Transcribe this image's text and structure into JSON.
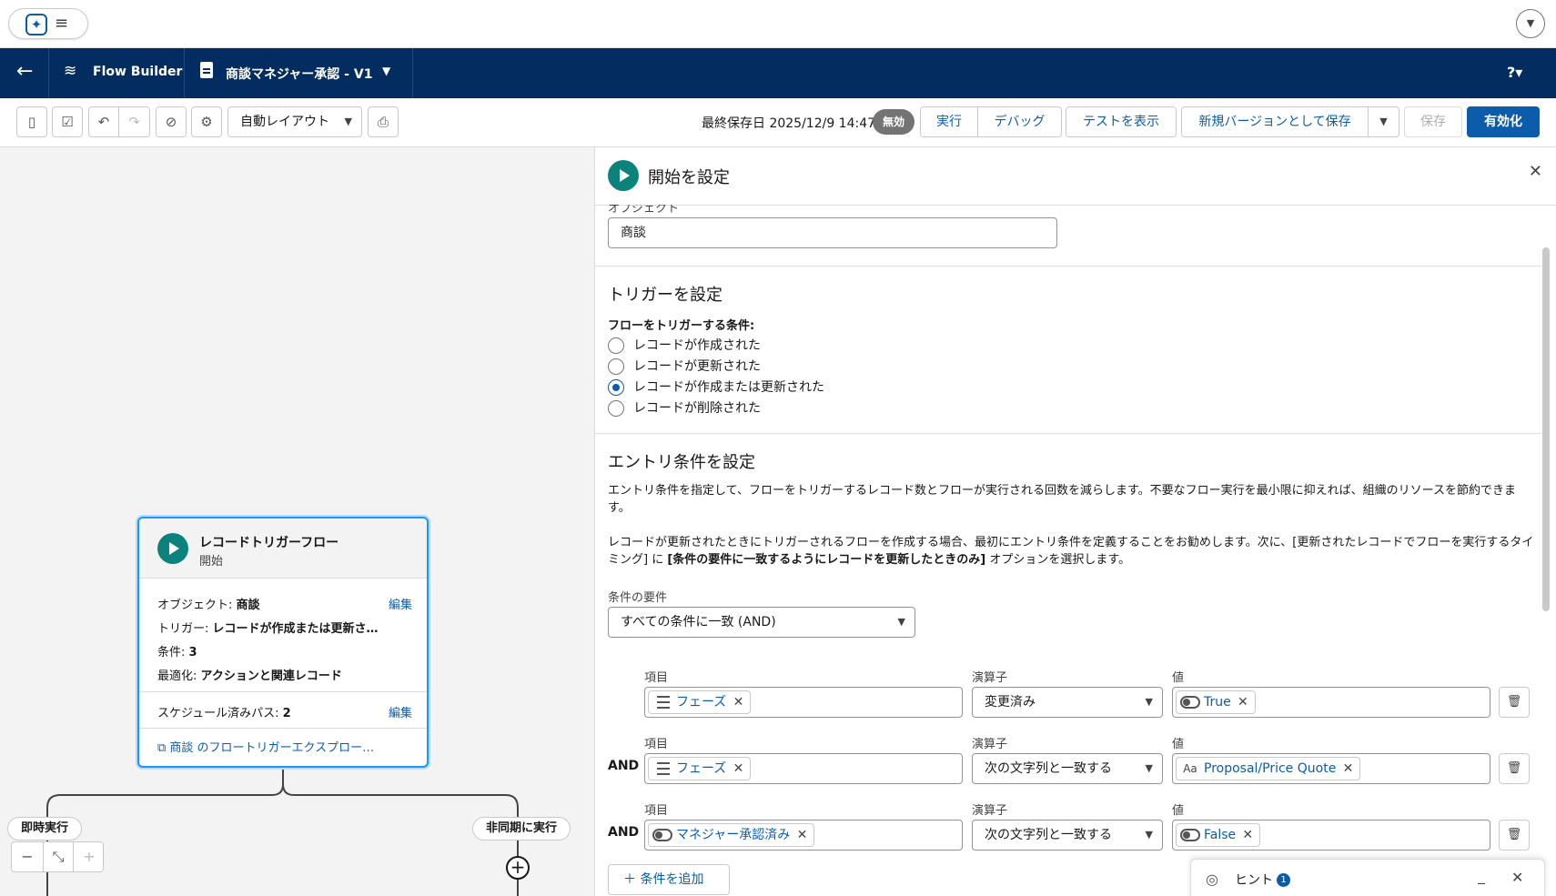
{
  "header": {
    "help_label": "?▾"
  },
  "nav": {
    "brand": "Flow Builder",
    "flow_name": "商談マネジャー承認 - V1"
  },
  "toolbar": {
    "layout_select": "自動レイアウト",
    "last_saved": "最終保存日 2025/12/9 14:47",
    "status_badge": "無効",
    "run": "実行",
    "debug": "デバッグ",
    "show_tests": "テストを表示",
    "save_as_new_version": "新規バージョンとして保存",
    "save": "保存",
    "activate": "有効化"
  },
  "canvas": {
    "node": {
      "title": "レコードトリガーフロー",
      "subtitle": "開始",
      "object_label": "オブジェクト: ",
      "object_value": "商談",
      "trigger_label": "トリガー: ",
      "trigger_value": "レコードが作成または更新さ…",
      "conditions_label": "条件: ",
      "conditions_value": "3",
      "optimize_label": "最適化: ",
      "optimize_value": "アクションと関連レコード",
      "scheduled_label": "スケジュール済みパス: ",
      "scheduled_value": "2",
      "edit": "編集",
      "explorer_link": "商談 のフロートリガーエクスプロー…"
    },
    "path_immediate": "即時実行",
    "path_async": "非同期に実行"
  },
  "panel": {
    "title": "開始を設定",
    "object_label": "オブジェクト",
    "object_value": "商談",
    "trigger_heading": "トリガーを設定",
    "trigger_question": "フローをトリガーする条件:",
    "trigger_options": [
      "レコードが作成された",
      "レコードが更新された",
      "レコードが作成または更新された",
      "レコードが削除された"
    ],
    "trigger_selected": 2,
    "entry_heading": "エントリ条件を設定",
    "entry_desc1": "エントリ条件を指定して、フローをトリガーするレコード数とフローが実行される回数を減らします。不要なフロー実行を最小限に抑えれば、組織のリソースを節約できます。",
    "entry_desc2_a": "レコードが更新されたときにトリガーされるフローを作成する場合、最初にエントリ条件を定義することをお勧めします。次に、[更新されたレコードでフローを実行するタイミング] に ",
    "entry_desc2_b": "[条件の要件に一致するようにレコードを更新したときのみ]",
    "entry_desc2_c": " オプションを選択します。",
    "requirement_label": "条件の要件",
    "requirement_value": "すべての条件に一致 (AND)",
    "col_field": "項目",
    "col_operator": "演算子",
    "col_value": "値",
    "conditions": [
      {
        "prefix": "",
        "field": "フェーズ",
        "operator": "変更済み",
        "value": "True"
      },
      {
        "prefix": "AND",
        "field": "フェーズ",
        "operator": "次の文字列と一致する",
        "value": "Proposal/Price Quote"
      },
      {
        "prefix": "AND",
        "field": "マネジャー承認済み",
        "operator": "次の文字列と一致する",
        "value": "False"
      }
    ],
    "add_condition": "条件を追加"
  },
  "hint": {
    "label": "ヒント",
    "count": "1"
  }
}
